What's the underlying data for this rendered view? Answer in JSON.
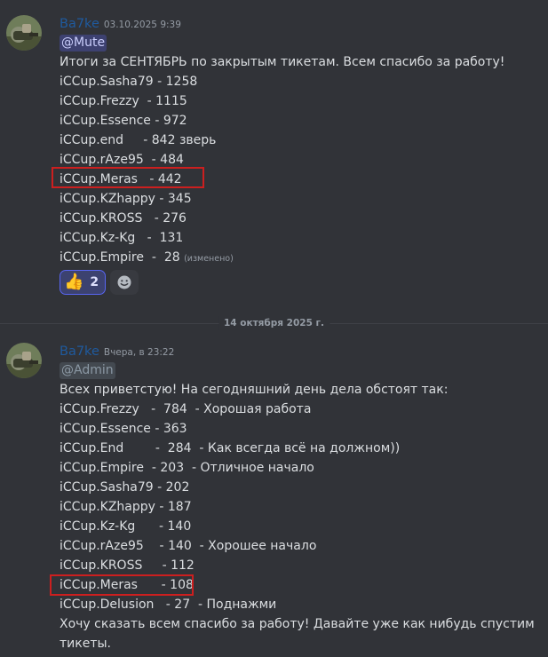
{
  "messages": [
    {
      "author": "Ba7ke",
      "timestamp": "03.10.2025 9:39",
      "mention": "@Mute",
      "title": "Итоги за СЕНТЯБРЬ по закрытым тикетам. Всем спасибо за работу!",
      "lines": [
        "iCCup.Sasha79 - 1258",
        "iCCup.Frezzy  - 1115",
        "iCCup.Essence - 972",
        "iCCup.end     - 842 зверь",
        "iCCup.rAze95  - 484",
        "iCCup.Meras   - 442",
        "iCCup.KZhappy - 345",
        "iCCup.KROSS   - 276",
        "iCCup.Kz-Kg   -  131",
        "iCCup.Empire  -  28 "
      ],
      "edited": "(изменено)",
      "reaction": {
        "emoji": "👍",
        "count": "2"
      },
      "add_reaction_icon": "smile-icon"
    },
    {
      "author": "Ba7ke",
      "timestamp": "Вчера, в 23:22",
      "mention": "@Admin",
      "lines": [
        "Всех приветстую! На сегодняшний день дела обстоят так:",
        "iCCup.Frezzy   -  784  - Хорошая работа",
        "iCCup.Essence - 363",
        "iCCup.End        -  284  - Как всегда всё на должном))",
        "iCCup.Empire  - 203  - Отличное начало",
        "iCCup.Sasha79 - 202",
        "iCCup.KZhappy - 187",
        "iCCup.Kz-Kg      - 140",
        "iCCup.rAze95    - 140  - Хорошее начало",
        "iCCup.KROSS     - 112",
        "iCCup.Meras      - 108",
        "iCCup.Delusion   - 27  - Поднажми",
        "Хочу сказать всем спасибо за работу! Давайте уже как нибудь спустим",
        "тикеты."
      ]
    }
  ],
  "divider": {
    "label": "14 октября 2025 г."
  },
  "colors": {
    "background": "#313338",
    "author": "#1f5a9e",
    "highlight": "#cc1f1f",
    "mention_mute": "#5865f2"
  }
}
